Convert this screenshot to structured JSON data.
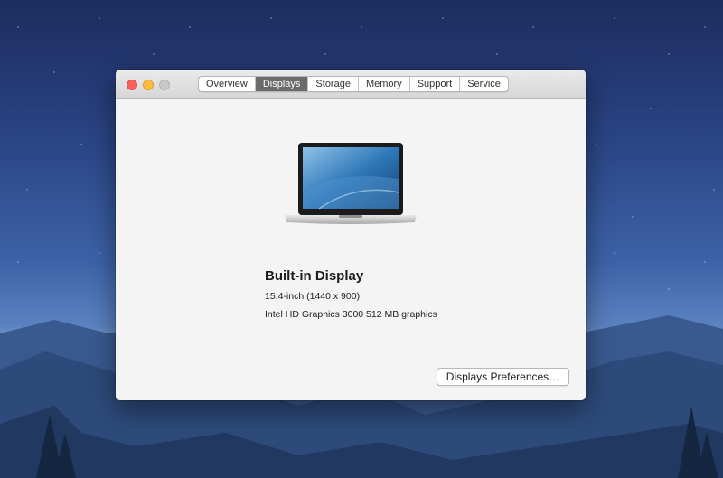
{
  "window": {
    "tabs": [
      {
        "label": "Overview",
        "active": false
      },
      {
        "label": "Displays",
        "active": true
      },
      {
        "label": "Storage",
        "active": false
      },
      {
        "label": "Memory",
        "active": false
      },
      {
        "label": "Support",
        "active": false
      },
      {
        "label": "Service",
        "active": false
      }
    ]
  },
  "display": {
    "title": "Built-in Display",
    "resolution": "15.4-inch (1440 x 900)",
    "graphics": "Intel HD Graphics 3000 512 MB graphics",
    "preferences_label": "Displays Preferences…",
    "icon": "laptop-icon"
  },
  "colors": {
    "close": "#fc605c",
    "minimize": "#fdbc40",
    "zoom": "#c9c9c9",
    "active_tab": "#6b6b6b"
  }
}
